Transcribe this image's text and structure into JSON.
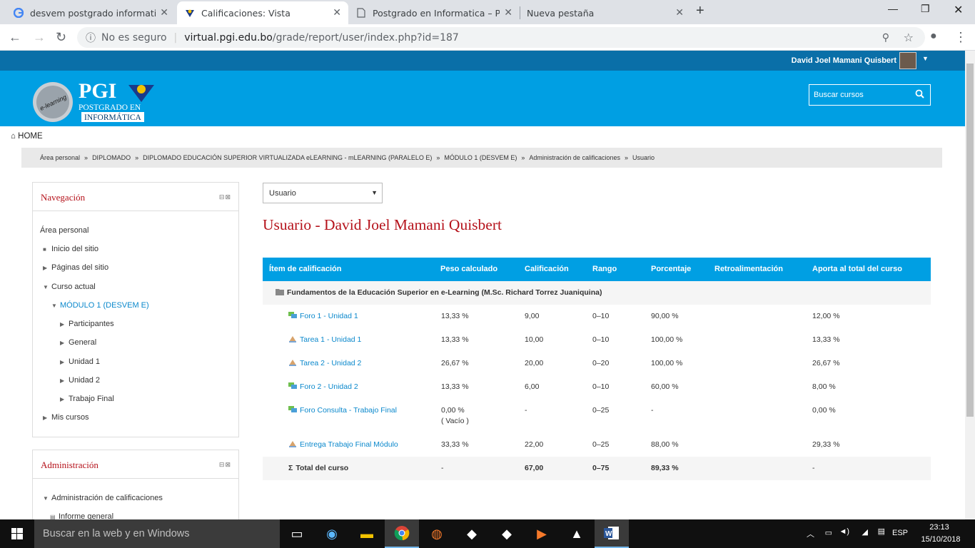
{
  "browser": {
    "tabs": [
      {
        "title": "desvem postgrado informatica -",
        "icon": "google-icon"
      },
      {
        "title": "Calificaciones: Vista",
        "icon": "pgi-icon"
      },
      {
        "title": "Postgrado en Informatica – PGI",
        "icon": "page-icon"
      },
      {
        "title": "Nueva pestaña",
        "icon": ""
      }
    ],
    "security": "No es seguro",
    "domain": "virtual.pgi.edu.bo",
    "path": "/grade/report/user/index.php?id=187"
  },
  "site": {
    "user_name": "David Joel Mamani Quisbert",
    "logo_text": "PGI",
    "logo_sub1": "POSTGRADO EN",
    "logo_sub2": "INFORMÁTICA",
    "logo_ring": "e-learning",
    "search_placeholder": "Buscar cursos",
    "home": "HOME"
  },
  "breadcrumb": [
    "Área personal",
    "DIPLOMADO",
    "DIPLOMADO EDUCACIÓN SUPERIOR VIRTUALIZADA eLEARNING - mLEARNING (PARALELO E)",
    "MÓDULO 1 (DESVEM E)",
    "Administración de calificaciones",
    "Usuario"
  ],
  "navigation": {
    "title": "Navegación",
    "items": {
      "area": "Área personal",
      "inicio": "Inicio del sitio",
      "paginas": "Páginas del sitio",
      "curso": "Curso actual",
      "modulo": "MÓDULO 1 (DESVEM E)",
      "participantes": "Participantes",
      "general": "General",
      "unidad1": "Unidad 1",
      "unidad2": "Unidad 2",
      "trabajo": "Trabajo Final",
      "mis": "Mis cursos"
    }
  },
  "administration": {
    "title": "Administración",
    "item1": "Administración de calificaciones",
    "item2": "Informe general"
  },
  "main": {
    "view_select": "Usuario",
    "title": "Usuario - David Joel Mamani Quisbert",
    "headers": [
      "Ítem de calificación",
      "Peso calculado",
      "Calificación",
      "Rango",
      "Porcentaje",
      "Retroalimentación",
      "Aporta al total del curso"
    ],
    "category": "Fundamentos de la Educación Superior en e-Learning (M.Sc. Richard Torrez Juaniquina)",
    "rows": [
      {
        "item": "Foro 1 - Unidad 1",
        "peso": "13,33 %",
        "cal": "9,00",
        "rango": "0–10",
        "pct": "90,00 %",
        "aporta": "12,00 %",
        "type": "forum"
      },
      {
        "item": "Tarea 1 - Unidad 1",
        "peso": "13,33 %",
        "cal": "10,00",
        "rango": "0–10",
        "pct": "100,00 %",
        "aporta": "13,33 %",
        "type": "assign"
      },
      {
        "item": "Tarea 2 - Unidad 2",
        "peso": "26,67 %",
        "cal": "20,00",
        "rango": "0–20",
        "pct": "100,00 %",
        "aporta": "26,67 %",
        "type": "assign"
      },
      {
        "item": "Foro 2 - Unidad 2",
        "peso": "13,33 %",
        "cal": "6,00",
        "rango": "0–10",
        "pct": "60,00 %",
        "aporta": "8,00 %",
        "type": "forum"
      },
      {
        "item": "Foro Consulta - Trabajo Final",
        "peso": "0,00 %",
        "peso2": "( Vacío )",
        "cal": "-",
        "rango": "0–25",
        "pct": "-",
        "aporta": "0,00 %",
        "type": "forum"
      },
      {
        "item": "Entrega Trabajo Final Módulo",
        "peso": "33,33 %",
        "cal": "22,00",
        "rango": "0–25",
        "pct": "88,00 %",
        "aporta": "29,33 %",
        "type": "assign"
      }
    ],
    "total": {
      "item": "Total del curso",
      "peso": "-",
      "cal": "67,00",
      "rango": "0–75",
      "pct": "89,33 %",
      "aporta": "-"
    }
  },
  "taskbar": {
    "search": "Buscar en la web y en Windows",
    "lang": "ESP",
    "time": "23:13",
    "date": "15/10/2018"
  }
}
